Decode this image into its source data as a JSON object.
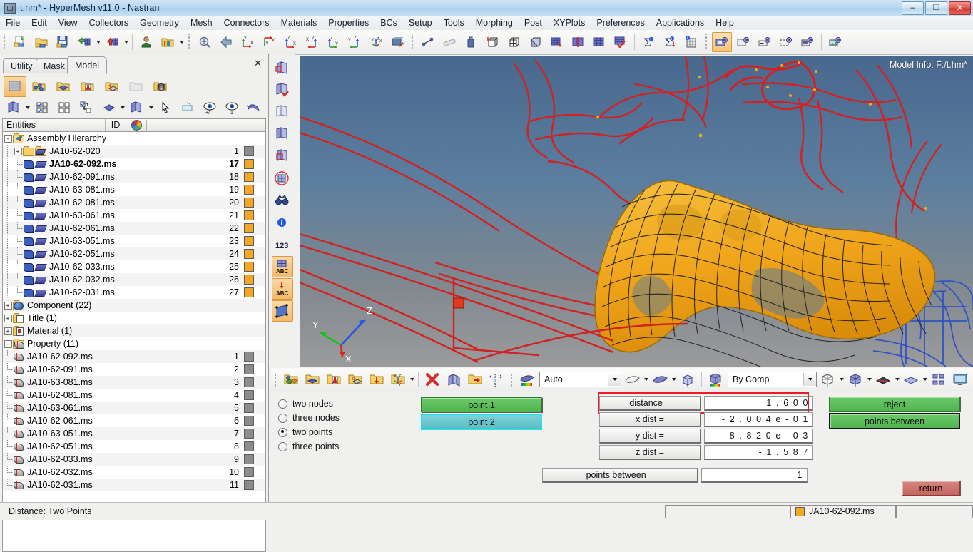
{
  "window": {
    "title": "t.hm* - HyperMesh v11.0 - Nastran",
    "icon": "hypermesh-logo-icon",
    "minimize": "–",
    "maximize": "❐",
    "close": "✕"
  },
  "menubar": {
    "items": [
      "File",
      "Edit",
      "View",
      "Collectors",
      "Geometry",
      "Mesh",
      "Connectors",
      "Materials",
      "Properties",
      "BCs",
      "Setup",
      "Tools",
      "Morphing",
      "Post",
      "XYPlots",
      "Preferences",
      "Applications",
      "Help"
    ]
  },
  "toolbar": {
    "groups": [
      [
        "new-model-icon",
        "open-model-icon",
        "save-model-icon",
        "import-icon",
        "import-dropdown",
        "export-icon",
        "export-dropdown"
      ],
      [
        "user-profile-icon",
        "load-userprofile-icon",
        "userprofile-dropdown"
      ],
      [
        "zoom-fit-icon",
        "previous-view-icon",
        "view-xy-icon",
        "view-yx-icon",
        "view-zx-icon",
        "view-xz-icon",
        "view-zy-icon",
        "view-yz-icon",
        "view-iso-icon",
        "rotate-view-icon"
      ],
      [
        "distance-icon",
        "measure-icon",
        "mass-calc-icon",
        "box-wire-icon",
        "box-center-icon",
        "box-solid-icon",
        "shrink-elem-icon",
        "mesh-edges-icon",
        "mesh-faces-icon",
        "mesh-check-icon"
      ],
      [
        "summary-icon",
        "summary-detail-icon",
        "matrix-browser-icon"
      ],
      [
        "save-image-icon",
        "capture-window-icon",
        "capture-video-icon",
        "capture-region-icon",
        "capture-screen-icon"
      ],
      [
        "publish-image-icon"
      ]
    ]
  },
  "left_panel": {
    "tabs": [
      {
        "label": "Utility",
        "active": false
      },
      {
        "label": "Mask",
        "active": false
      },
      {
        "label": "Model",
        "active": true
      }
    ],
    "close_icon": "✕",
    "tool_row1": [
      "collector-icon",
      "assembly-icon",
      "component-icon",
      "material-icon",
      "property-icon",
      "set-icon",
      "stack-icon"
    ],
    "tool_row2": [
      "display-all-icon",
      "display-dropdown",
      "check-all-icon",
      "uncheck-all-icon",
      "reverse-all-icon",
      "geom-display-icon",
      "geom-dropdown",
      "elem-display-icon",
      "elem-dropdown",
      "cursor-icon",
      "isolate-icon",
      "show-hide-icon",
      "show-only-icon",
      "undo-display-icon"
    ],
    "columns": {
      "entities": "Entities",
      "id": "ID",
      "color": "color-wheel-icon"
    },
    "tree": [
      {
        "level": 0,
        "icon": "assembly-folder-icon",
        "label": "Assembly Hierarchy",
        "id": "",
        "color": "",
        "expander": "-"
      },
      {
        "level": 1,
        "icon": "assembly-icon",
        "label": "JA10-62-020",
        "id": "1",
        "color": "#8c8c8c",
        "expander": "+"
      },
      {
        "level": 2,
        "icon": "component-icon",
        "label": "JA10-62-092.ms",
        "id": "17",
        "color": "#f5a623",
        "bold": true
      },
      {
        "level": 2,
        "icon": "component-icon",
        "label": "JA10-62-091.ms",
        "id": "18",
        "color": "#f5a623"
      },
      {
        "level": 2,
        "icon": "component-icon",
        "label": "JA10-63-081.ms",
        "id": "19",
        "color": "#f5a623"
      },
      {
        "level": 2,
        "icon": "component-icon",
        "label": "JA10-62-081.ms",
        "id": "20",
        "color": "#f5a623"
      },
      {
        "level": 2,
        "icon": "component-icon",
        "label": "JA10-63-061.ms",
        "id": "21",
        "color": "#f5a623"
      },
      {
        "level": 2,
        "icon": "component-icon",
        "label": "JA10-62-061.ms",
        "id": "22",
        "color": "#f5a623"
      },
      {
        "level": 2,
        "icon": "component-icon",
        "label": "JA10-63-051.ms",
        "id": "23",
        "color": "#f5a623"
      },
      {
        "level": 2,
        "icon": "component-icon",
        "label": "JA10-62-051.ms",
        "id": "24",
        "color": "#f5a623"
      },
      {
        "level": 2,
        "icon": "component-icon",
        "label": "JA10-62-033.ms",
        "id": "25",
        "color": "#f5a623"
      },
      {
        "level": 2,
        "icon": "component-icon",
        "label": "JA10-62-032.ms",
        "id": "26",
        "color": "#f5a623"
      },
      {
        "level": 2,
        "icon": "component-icon",
        "label": "JA10-62-031.ms",
        "id": "27",
        "color": "#f5a623"
      },
      {
        "level": 0,
        "icon": "component-folder-icon",
        "label": "Component (22)",
        "id": "",
        "color": "",
        "expander": "+"
      },
      {
        "level": 0,
        "icon": "title-folder-icon",
        "label": "Title (1)",
        "id": "",
        "color": "",
        "expander": "+"
      },
      {
        "level": 0,
        "icon": "material-folder-icon",
        "label": "Material (1)",
        "id": "",
        "color": "",
        "expander": "+"
      },
      {
        "level": 0,
        "icon": "property-folder-icon",
        "label": "Property (11)",
        "id": "",
        "color": "",
        "expander": "-"
      },
      {
        "level": 1,
        "icon": "property-icon",
        "label": "JA10-62-092.ms",
        "id": "1",
        "color": "#8c8c8c"
      },
      {
        "level": 1,
        "icon": "property-icon",
        "label": "JA10-62-091.ms",
        "id": "2",
        "color": "#8c8c8c"
      },
      {
        "level": 1,
        "icon": "property-icon",
        "label": "JA10-63-081.ms",
        "id": "3",
        "color": "#8c8c8c"
      },
      {
        "level": 1,
        "icon": "property-icon",
        "label": "JA10-62-081.ms",
        "id": "4",
        "color": "#8c8c8c"
      },
      {
        "level": 1,
        "icon": "property-icon",
        "label": "JA10-63-061.ms",
        "id": "5",
        "color": "#8c8c8c"
      },
      {
        "level": 1,
        "icon": "property-icon",
        "label": "JA10-62-061.ms",
        "id": "6",
        "color": "#8c8c8c"
      },
      {
        "level": 1,
        "icon": "property-icon",
        "label": "JA10-63-051.ms",
        "id": "7",
        "color": "#8c8c8c"
      },
      {
        "level": 1,
        "icon": "property-icon",
        "label": "JA10-62-051.ms",
        "id": "8",
        "color": "#8c8c8c"
      },
      {
        "level": 1,
        "icon": "property-icon",
        "label": "JA10-62-033.ms",
        "id": "9",
        "color": "#8c8c8c"
      },
      {
        "level": 1,
        "icon": "property-icon",
        "label": "JA10-62-032.ms",
        "id": "10",
        "color": "#8c8c8c"
      },
      {
        "level": 1,
        "icon": "property-icon",
        "label": "JA10-62-031.ms",
        "id": "11",
        "color": "#8c8c8c"
      }
    ]
  },
  "viewport_toolbar_left": {
    "buttons": [
      "mesh-visibility-icon",
      "mesh-apply-icon",
      "mesh-wire-icon",
      "mesh-solid-icon",
      "mesh-sub-icon",
      "mesh-circle-icon",
      "binoculars-icon",
      "info-icon",
      "numbers-123-icon",
      "elem-abc-icon",
      "node-abc-icon",
      "surface-icon"
    ]
  },
  "viewport": {
    "model_info": "Model Info: F:/t.hm*",
    "axis_labels": {
      "x": "X",
      "y": "Y",
      "z": "Z"
    },
    "axis_colors": {
      "x": "#e02020",
      "y": "#14c414",
      "z": "#2458e0"
    },
    "background_top": "#4d6d8f",
    "background_bottom": "#98989a",
    "mesh_color": "#f2a913",
    "wire_color": "#d02020",
    "secondary_wire_color": "#2a50c8"
  },
  "view_toolbar": {
    "left_icons": [
      "collectors-icon",
      "component-solid-icon",
      "material-icon",
      "property-icon",
      "load-icon",
      "system-icon",
      "system-dropdown"
    ],
    "mid_icons": [
      "delete-icon",
      "layers-icon",
      "organize-icon",
      "renumber-icon"
    ],
    "shade_mode": {
      "label": "Auto",
      "icon": "shade-auto-icon",
      "dropdown": "chevron-down-icon"
    },
    "shade_extra": [
      "wire-mode-icon",
      "wire-dropdown",
      "solid-mode-icon",
      "solid-dropdown",
      "iso-cube-icon"
    ],
    "color_mode": {
      "label": "By Comp",
      "icon": "color-by-comp-icon",
      "dropdown": "chevron-down-icon"
    },
    "right_icons": [
      "wire-cube-icon",
      "wire-cube-dropdown",
      "solid-cube-icon",
      "solid-cube-dropdown",
      "shell-icon",
      "shell-dropdown",
      "plate-icon",
      "plate-dropdown",
      "window-tile-icon",
      "monitor-icon"
    ]
  },
  "command_panel": {
    "modes": [
      {
        "label": "two nodes",
        "selected": false
      },
      {
        "label": "three nodes",
        "selected": false
      },
      {
        "label": "two points",
        "selected": true
      },
      {
        "label": "three points",
        "selected": false
      }
    ],
    "point_buttons": [
      {
        "label": "point 1",
        "style": "green"
      },
      {
        "label": "point 2",
        "style": "cyan"
      }
    ],
    "fields": [
      {
        "label": "distance =",
        "value": "1 . 6 0 0",
        "highlighted": true
      },
      {
        "label": "x dist  =",
        "value": "- 2 . 0 0 4 e - 0 1",
        "highlighted": false
      },
      {
        "label": "y dist  =",
        "value": "8 . 8 2 0 e - 0 3",
        "highlighted": false
      },
      {
        "label": "z dist  =",
        "value": "- 1 . 5 8 7",
        "highlighted": false
      }
    ],
    "points_between": {
      "label": "points between =",
      "value": "1"
    },
    "actions": [
      {
        "label": "reject",
        "style": "green"
      },
      {
        "label": "points between",
        "style": "green-focus"
      }
    ],
    "return_button": {
      "label": "return",
      "style": "red"
    }
  },
  "statusbar": {
    "message": "Distance: Two Points",
    "component_field": {
      "swatch_color": "#f5a623",
      "label": "JA10-62-092.ms"
    },
    "extra_field": ""
  }
}
